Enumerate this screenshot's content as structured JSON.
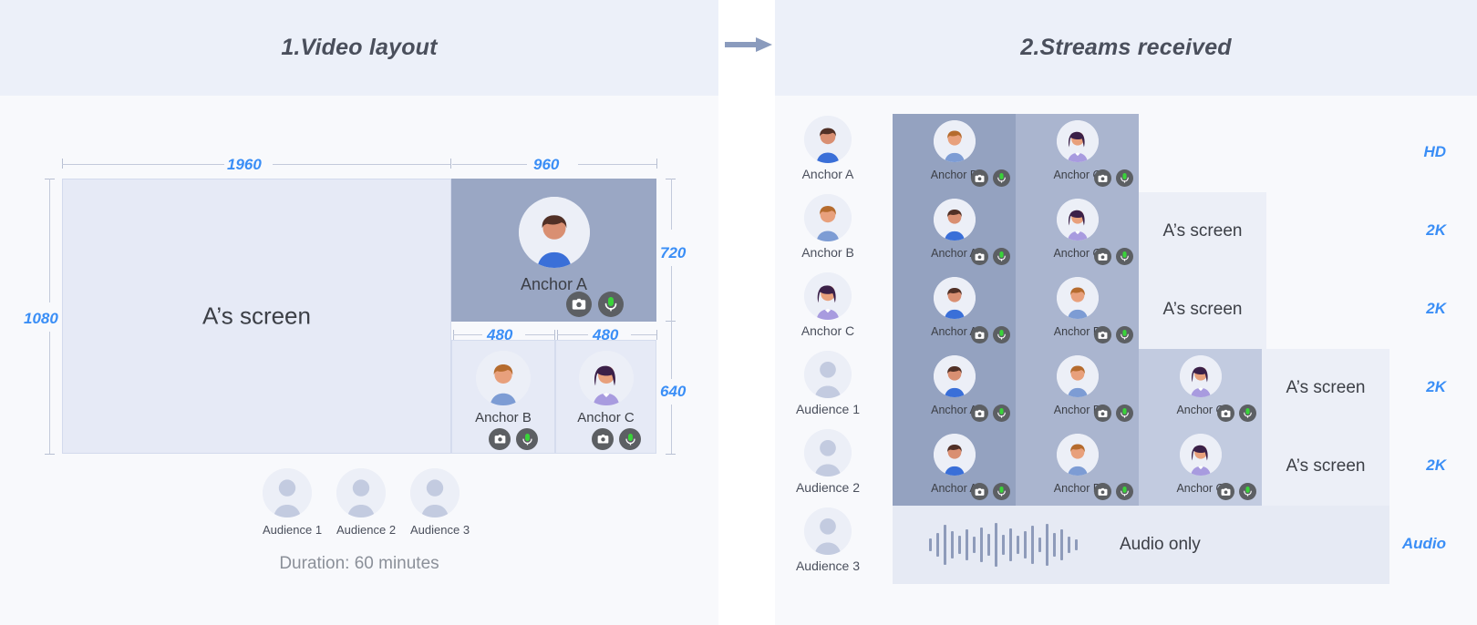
{
  "left": {
    "title": "1.Video layout",
    "dimensions": {
      "width_total": "1960",
      "height_total": "1080",
      "anchor_a_width": "960",
      "anchor_a_height": "720",
      "small_width_b": "480",
      "small_width_c": "480",
      "small_height": "640"
    },
    "screen_label": "A’s screen",
    "tiles": [
      {
        "name": "Anchor A",
        "avatar": "male-dark"
      },
      {
        "name": "Anchor B",
        "avatar": "male-orange"
      },
      {
        "name": "Anchor C",
        "avatar": "female-purple"
      }
    ],
    "audience": [
      {
        "label": "Audience 1"
      },
      {
        "label": "Audience 2"
      },
      {
        "label": "Audience 3"
      }
    ],
    "duration": "Duration: 60 minutes"
  },
  "right": {
    "title": "2.Streams received",
    "screen_label": "A’s screen",
    "audio_label": "Audio only",
    "rows": [
      {
        "viewer": "Anchor A",
        "viewer_avatar": "male-dark",
        "quality": "HD",
        "has_screen": false,
        "audio_only": false,
        "cells": [
          {
            "name": "Anchor B",
            "avatar": "male-orange"
          },
          {
            "name": "Anchor C",
            "avatar": "female-purple"
          }
        ]
      },
      {
        "viewer": "Anchor B",
        "viewer_avatar": "male-orange",
        "quality": "2K",
        "has_screen": true,
        "audio_only": false,
        "cells": [
          {
            "name": "Anchor A",
            "avatar": "male-dark"
          },
          {
            "name": "Anchor C",
            "avatar": "female-purple"
          }
        ]
      },
      {
        "viewer": "Anchor C",
        "viewer_avatar": "female-purple",
        "quality": "2K",
        "has_screen": true,
        "audio_only": false,
        "cells": [
          {
            "name": "Anchor A",
            "avatar": "male-dark"
          },
          {
            "name": "Anchor B",
            "avatar": "male-orange"
          }
        ]
      },
      {
        "viewer": "Audience 1",
        "viewer_avatar": "generic",
        "quality": "2K",
        "has_screen": true,
        "audio_only": false,
        "cells": [
          {
            "name": "Anchor A",
            "avatar": "male-dark"
          },
          {
            "name": "Anchor B",
            "avatar": "male-orange"
          },
          {
            "name": "Anchor C",
            "avatar": "female-purple"
          }
        ]
      },
      {
        "viewer": "Audience 2",
        "viewer_avatar": "generic",
        "quality": "2K",
        "has_screen": true,
        "audio_only": false,
        "cells": [
          {
            "name": "Anchor A",
            "avatar": "male-dark"
          },
          {
            "name": "Anchor B",
            "avatar": "male-orange"
          },
          {
            "name": "Anchor C",
            "avatar": "female-purple"
          }
        ]
      },
      {
        "viewer": "Audience 3",
        "viewer_avatar": "generic",
        "quality": "Audio",
        "has_screen": false,
        "audio_only": true,
        "cells": []
      }
    ],
    "waveform": [
      14,
      26,
      44,
      30,
      20,
      34,
      18,
      38,
      24,
      48,
      22,
      36,
      20,
      30,
      42,
      16,
      46,
      26,
      34,
      18,
      12
    ]
  },
  "colors": {
    "accent": "#3a8ef6",
    "header_bg": "#ecf0f9",
    "page_bg": "#f8f9fc",
    "tile_dark": "#9aa7c4",
    "screen_fill": "#e6eaf6",
    "mic_green": "#3ad33a",
    "arrow": "#8a9bbd"
  },
  "icons": {
    "camera": "camera-icon",
    "mic": "microphone-icon",
    "arrow": "arrow-right-icon"
  }
}
